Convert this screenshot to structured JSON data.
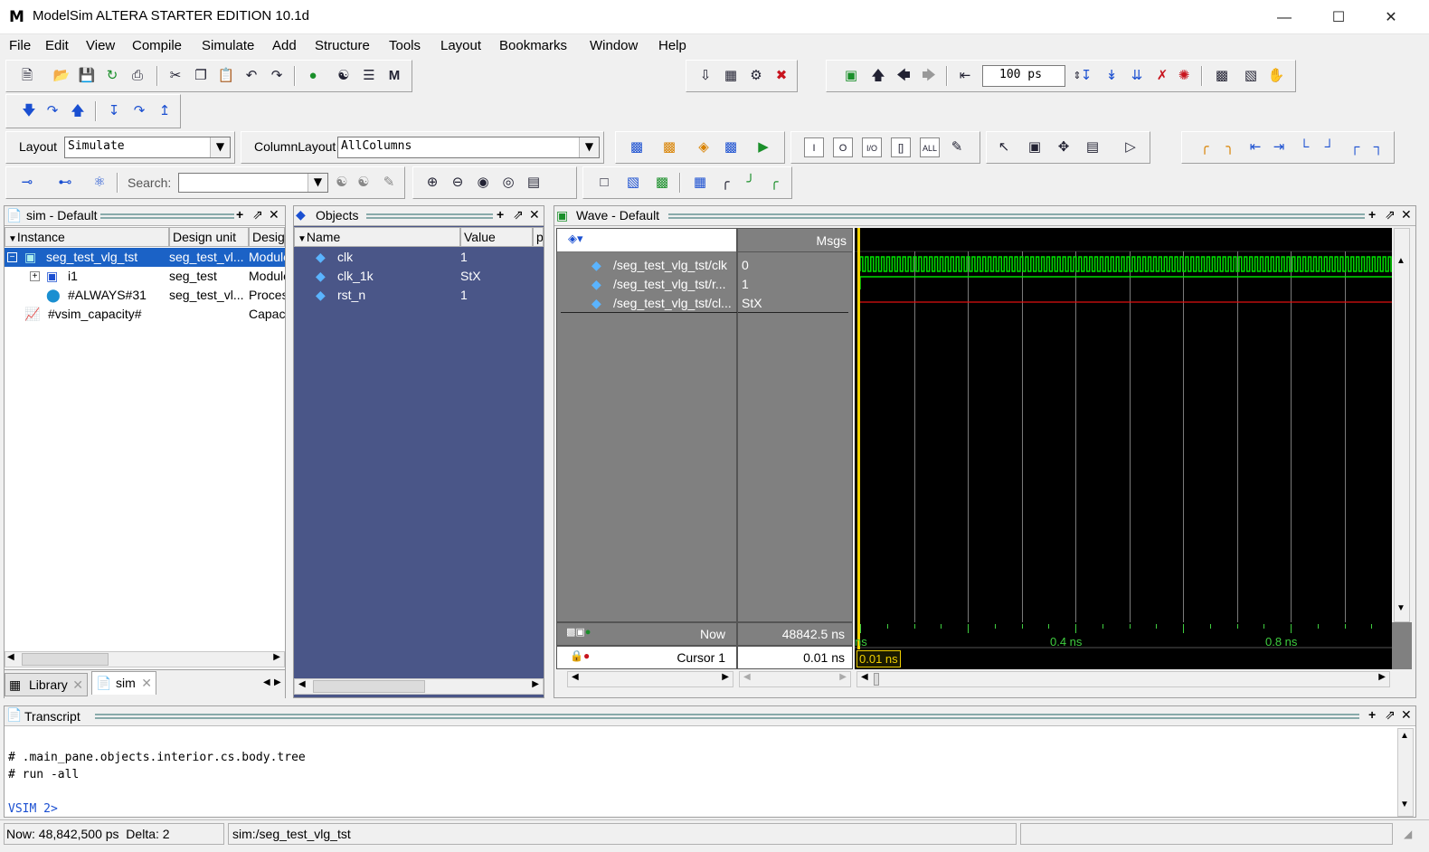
{
  "window": {
    "title": "ModelSim ALTERA STARTER EDITION 10.1d",
    "logo": "M"
  },
  "menus": [
    "File",
    "Edit",
    "View",
    "Compile",
    "Simulate",
    "Add",
    "Structure",
    "Tools",
    "Layout",
    "Bookmarks",
    "Window",
    "Help"
  ],
  "toolbar": {
    "layout_label": "Layout",
    "layout_value": "Simulate",
    "column_layout_label": "ColumnLayout",
    "column_layout_value": "AllColumns",
    "search_label": "Search:",
    "search_value": "",
    "run_length": "100 ps"
  },
  "sim_pane": {
    "title": "sim - Default",
    "columns": [
      "Instance",
      "Design unit",
      "Design"
    ],
    "rows": [
      {
        "instance": "seg_test_vlg_tst",
        "unit": "seg_test_vl...",
        "type": "Module"
      },
      {
        "instance": "i1",
        "unit": "seg_test",
        "type": "Module"
      },
      {
        "instance": "#ALWAYS#31",
        "unit": "seg_test_vl...",
        "type": "Process"
      },
      {
        "instance": "#vsim_capacity#",
        "unit": "",
        "type": "Capacity"
      }
    ],
    "tabs": [
      "Library",
      "sim"
    ]
  },
  "objects_pane": {
    "title": "Objects",
    "columns": [
      "Name",
      "Value",
      "p"
    ],
    "rows": [
      {
        "name": "clk",
        "value": "1"
      },
      {
        "name": "clk_1k",
        "value": "StX"
      },
      {
        "name": "rst_n",
        "value": "1"
      }
    ]
  },
  "wave_pane": {
    "title": "Wave - Default",
    "msgs_label": "Msgs",
    "signals": [
      {
        "name": "/seg_test_vlg_tst/clk",
        "value": "0",
        "color": "#00e000"
      },
      {
        "name": "/seg_test_vlg_tst/r...",
        "value": "1",
        "color": "#00e000"
      },
      {
        "name": "/seg_test_vlg_tst/cl...",
        "value": "StX",
        "color": "#e01010"
      }
    ],
    "now_label": "Now",
    "now_value": "48842.5 ns",
    "cursor_label": "Cursor 1",
    "cursor_value": "0.01 ns",
    "cursor_tag": "0.01 ns",
    "timeline_labels": [
      "ns",
      "0.4 ns",
      "0.8 ns"
    ]
  },
  "transcript": {
    "title": "Transcript",
    "lines": [
      "# .main_pane.objects.interior.cs.body.tree",
      "# run -all",
      ""
    ],
    "prompt": "VSIM 2>"
  },
  "statusbar": {
    "now": "Now: 48,842,500 ps  Delta: 2",
    "context": "sim:/seg_test_vlg_tst"
  },
  "colors": {
    "wave_bg": "#000000",
    "objects_bg": "#4a5688",
    "cursor": "#f0d000",
    "signal_green": "#00e000",
    "signal_red": "#e01010",
    "wave_names_bg": "#808080"
  }
}
